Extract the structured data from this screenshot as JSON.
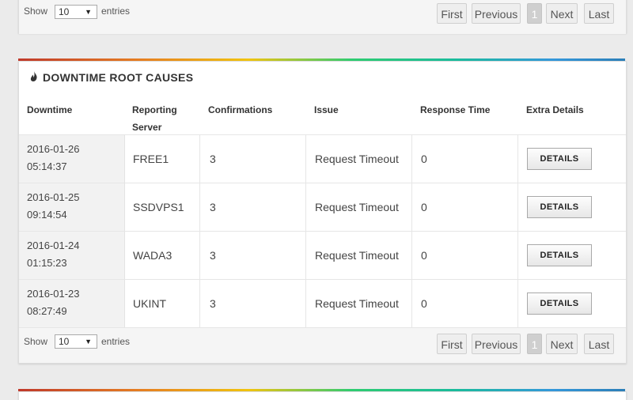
{
  "top_pager": {
    "show_label": "Show",
    "page_size": "10",
    "entries_label": "entries",
    "buttons": {
      "first": "First",
      "previous": "Previous",
      "current": "1",
      "next": "Next",
      "last": "Last"
    }
  },
  "downtime_panel": {
    "title": "DOWNTIME ROOT CAUSES",
    "title_icon": "fire-icon",
    "columns": {
      "downtime": "Downtime",
      "reporting_server_1": "Reporting",
      "reporting_server_2": "Server",
      "confirmations": "Confirmations",
      "issue": "Issue",
      "response_time": "Response Time",
      "extra_details": "Extra Details"
    },
    "rows": [
      {
        "date": "2016-01-26",
        "time": "05:14:37",
        "server": "FREE1",
        "confirmations": "3",
        "issue": "Request Timeout",
        "response_time": "0",
        "details_label": "DETAILS"
      },
      {
        "date": "2016-01-25",
        "time": "09:14:54",
        "server": "SSDVPS1",
        "confirmations": "3",
        "issue": "Request Timeout",
        "response_time": "0",
        "details_label": "DETAILS"
      },
      {
        "date": "2016-01-24",
        "time": "01:15:23",
        "server": "WADA3",
        "confirmations": "3",
        "issue": "Request Timeout",
        "response_time": "0",
        "details_label": "DETAILS"
      },
      {
        "date": "2016-01-23",
        "time": "08:27:49",
        "server": "UKINT",
        "confirmations": "3",
        "issue": "Request Timeout",
        "response_time": "0",
        "details_label": "DETAILS"
      }
    ],
    "pager": {
      "show_label": "Show",
      "page_size": "10",
      "entries_label": "entries",
      "buttons": {
        "first": "First",
        "previous": "Previous",
        "current": "1",
        "next": "Next",
        "last": "Last"
      }
    }
  },
  "colors": {
    "page_bg": "#ebebeb",
    "panel_bg": "#ffffff",
    "footer_bg": "#f5f5f5",
    "current_page_bg": "#cfcfcf"
  }
}
